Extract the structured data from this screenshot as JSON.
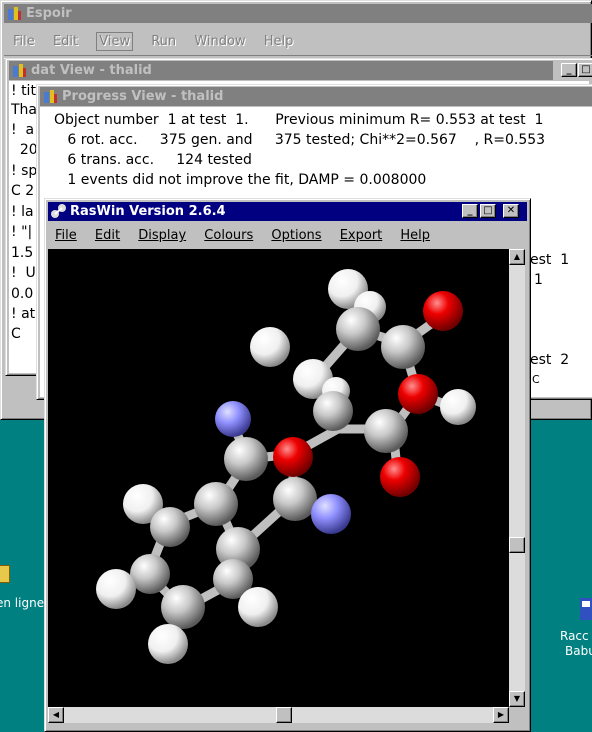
{
  "espoir": {
    "title": "Espoir",
    "menu": [
      "File",
      "Edit",
      "View",
      "Run",
      "Window",
      "Help"
    ]
  },
  "dat_view": {
    "title": "dat View - thalid",
    "lines": [
      "! tit",
      "Tha",
      "!  a",
      "  20",
      "! sp",
      "C 2",
      "! la",
      "! \"|",
      "1.5",
      "!  U",
      "0.0",
      "! at",
      "C"
    ]
  },
  "progress_view": {
    "title": "Progress View - thalid",
    "lines": [
      "Object number  1 at test  1.      Previous minimum R= 0.553 at test  1",
      "   6 rot. acc.     375 gen. and     375 tested; Chi**2=0.567    , R=0.553",
      "   6 trans. acc.     124 tested",
      "   1 events did not improve the fit, DAMP = 0.008000"
    ],
    "right_fragments": [
      "est  1",
      "1",
      "est  2",
      "C"
    ]
  },
  "raswin": {
    "title": "RasWin Version 2.6.4",
    "menu": [
      "File",
      "Edit",
      "Display",
      "Colours",
      "Options",
      "Export",
      "Help"
    ],
    "scroll_up": "▲",
    "scroll_down": "▼",
    "scroll_left": "◀",
    "scroll_right": "▶"
  },
  "desktop": {
    "left_label": "en ligne",
    "right_label_1": "Racc",
    "right_label_2": "Babu"
  },
  "colors": {
    "desktop": "#008080",
    "active_title": "#000080",
    "inactive_title": "#808080",
    "carbon": "#bdbdbd",
    "oxygen": "#ff0000",
    "nitrogen": "#8f8fff",
    "hydrogen": "#ffffff"
  },
  "icons": [
    "app-icon",
    "minimize-icon",
    "maximize-icon",
    "close-icon",
    "scroll-arrow-icon"
  ]
}
